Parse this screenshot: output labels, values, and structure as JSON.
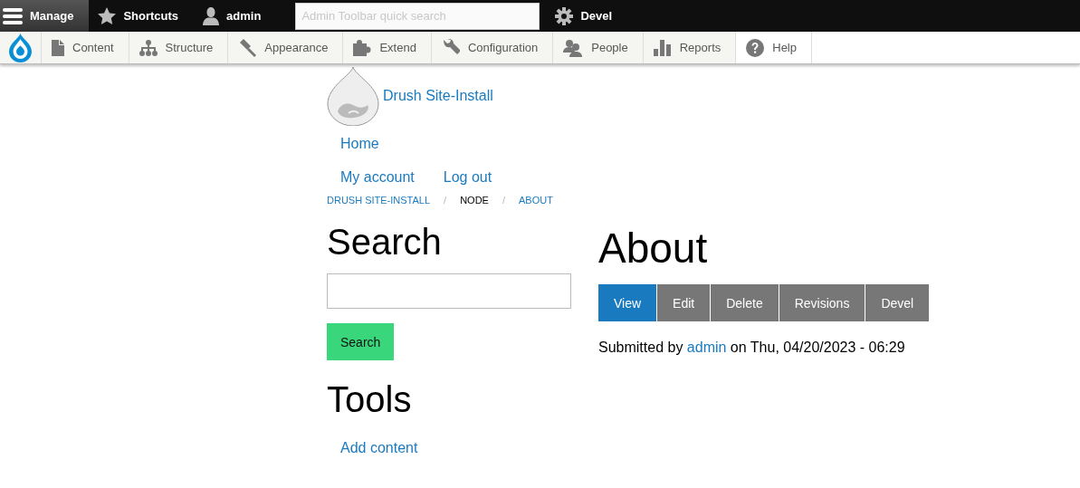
{
  "toolbar": {
    "items": [
      {
        "label": "Manage",
        "selected": true
      },
      {
        "label": "Shortcuts",
        "selected": false
      },
      {
        "label": "admin",
        "selected": false
      }
    ],
    "search": {
      "placeholder": "Admin Toolbar quick search"
    },
    "extra": [
      {
        "label": "Devel",
        "selected": false
      }
    ]
  },
  "tray": {
    "items": [
      {
        "label": "Content",
        "shaded": true
      },
      {
        "label": "Structure",
        "shaded": true
      },
      {
        "label": "Appearance",
        "shaded": true
      },
      {
        "label": "Extend",
        "shaded": true
      },
      {
        "label": "Configuration",
        "shaded": true
      },
      {
        "label": "People",
        "shaded": true
      },
      {
        "label": "Reports",
        "shaded": true
      },
      {
        "label": "Help",
        "shaded": false
      }
    ]
  },
  "site": {
    "name": "Drush Site-Install"
  },
  "main_menu": [
    "Home"
  ],
  "account_menu": [
    "My account",
    "Log out"
  ],
  "breadcrumb": [
    {
      "kind": "link",
      "label": "DRUSH SITE-INSTALL"
    },
    {
      "kind": "separator",
      "label": "/"
    },
    {
      "kind": "current",
      "label": "NODE"
    },
    {
      "kind": "separator",
      "label": "/"
    },
    {
      "kind": "link",
      "label": "ABOUT"
    }
  ],
  "sidebar": {
    "search_title": "Search",
    "search_button": "Search",
    "tools_title": "Tools",
    "tools_links": [
      "Add content"
    ]
  },
  "content": {
    "title": "About",
    "tabs": [
      {
        "label": "View",
        "selected": true
      },
      {
        "label": "Edit",
        "selected": false
      },
      {
        "label": "Delete",
        "selected": false
      },
      {
        "label": "Revisions",
        "selected": false
      },
      {
        "label": "Devel",
        "selected": false
      }
    ],
    "submitted": {
      "prefix": "Submitted by",
      "author": "admin",
      "suffix": "on Thu, 04/20/2023 - 06:29"
    }
  }
}
